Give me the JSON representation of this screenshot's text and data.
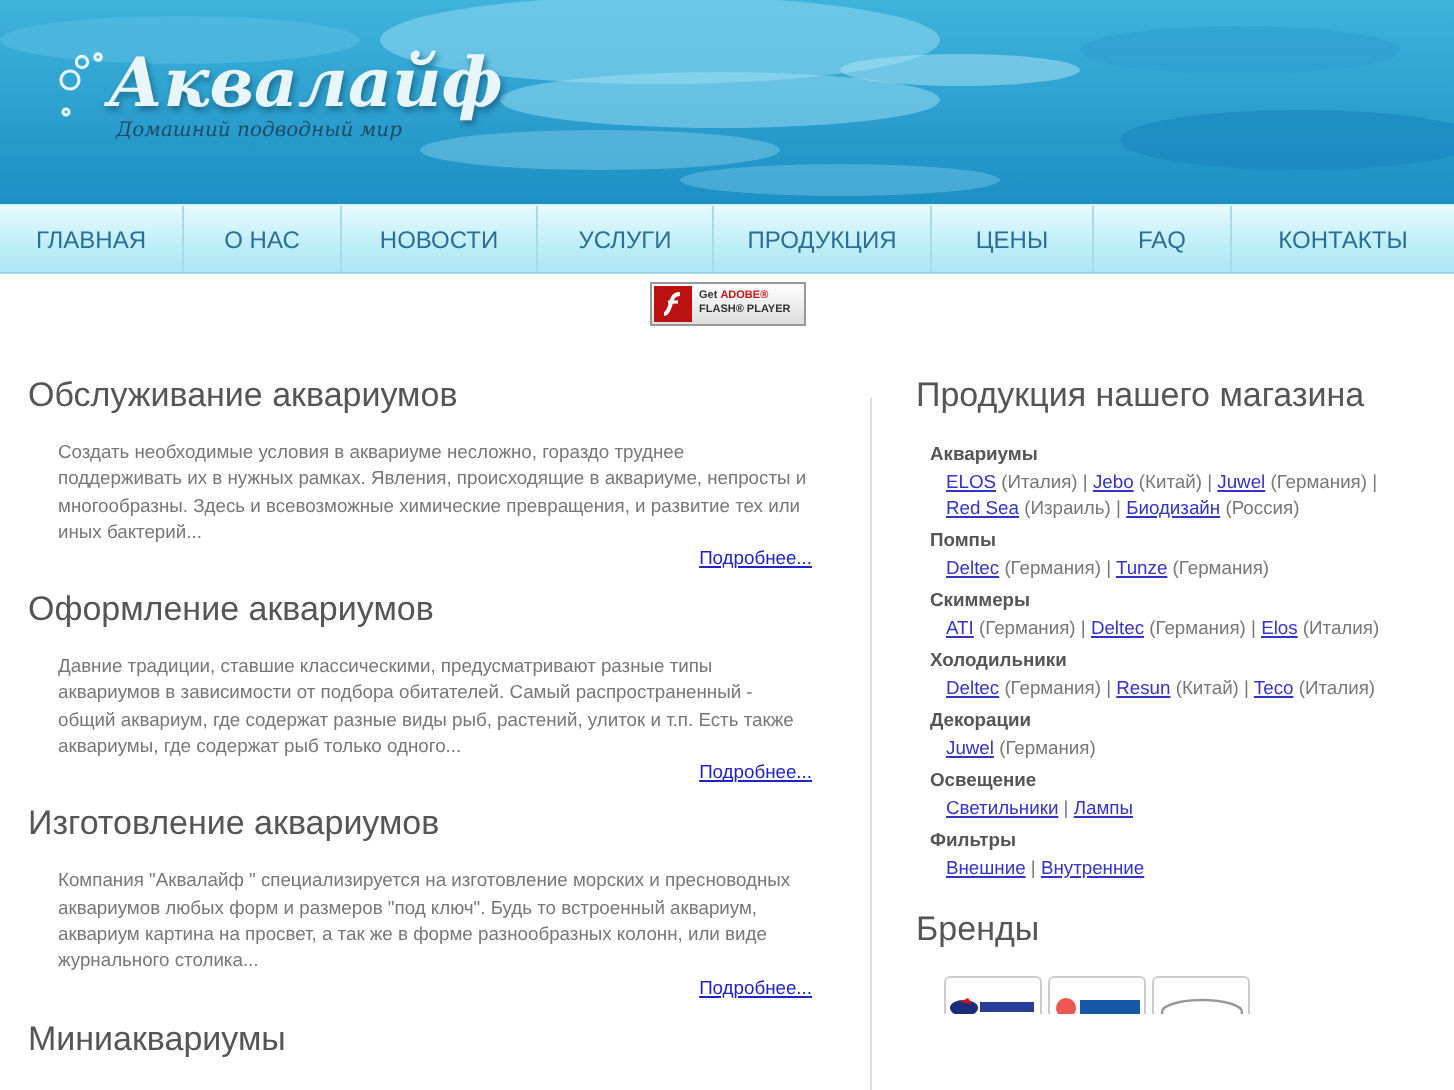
{
  "logo": {
    "title": "Аквалайф",
    "tagline": "Домашний подводный мир"
  },
  "nav": [
    {
      "label": "ГЛАВНАЯ"
    },
    {
      "label": "О НАС"
    },
    {
      "label": "НОВОСТИ"
    },
    {
      "label": "УСЛУГИ"
    },
    {
      "label": "ПРОДУКЦИЯ"
    },
    {
      "label": "ЦЕНЫ"
    },
    {
      "label": "FAQ"
    },
    {
      "label": "КОНТАКТЫ"
    }
  ],
  "flash_badge": {
    "line1": "Get",
    "brand": "ADOBE®",
    "line2": "FLASH® PLAYER"
  },
  "articles": [
    {
      "title": "Обслуживание аквариумов",
      "text": "Создать необходимые условия в аквариуме несложно, гораздо труднее поддерживать их в нужных рамках. Явления, происходящие в аквариуме, непросты и многообразны. Здесь и всевозможные химические превращения, и развитие тех или иных бактерий...",
      "more": "Подробнее..."
    },
    {
      "title": "Оформление аквариумов",
      "text": "Давние традиции, ставшие классическими, предусматривают разные типы аквариумов в зависимости от подбора обитателей. Самый распространенный - общий аквариум, где содержат разные виды рыб, растений, улиток и т.п. Есть также аквариумы, где содержат рыб только одного...",
      "more": "Подробнее..."
    },
    {
      "title": "Изготовление аквариумов",
      "text": "Компания \"Аквалайф \" специализируется на изготовление морских и пресноводных аквариумов любых форм и размеров \"под ключ\". Будь то встроенный аквариум, аквариум картина на просвет, а так же в форме разнообразных колонн, или виде журнального столика...",
      "more": "Подробнее..."
    },
    {
      "title": "Миниаквариумы"
    }
  ],
  "products": {
    "title": "Продукция нашего магазина",
    "separator": "|",
    "groups": [
      {
        "name": "Аквариумы",
        "items": [
          {
            "link": "ELOS",
            "note": "(Италия)"
          },
          {
            "link": "Jebo",
            "note": "(Китай)"
          },
          {
            "link": "Juwel",
            "note": "(Германия)"
          },
          {
            "link": "Red Sea",
            "note": "(Израиль)"
          },
          {
            "link": "Биодизайн",
            "note": "(Россия)"
          }
        ]
      },
      {
        "name": "Помпы",
        "items": [
          {
            "link": "Deltec",
            "note": "(Германия)"
          },
          {
            "link": "Tunze",
            "note": "(Германия)"
          }
        ]
      },
      {
        "name": "Скиммеры",
        "items": [
          {
            "link": "ATI",
            "note": "(Германия)"
          },
          {
            "link": "Deltec",
            "note": "(Германия)"
          },
          {
            "link": "Elos",
            "note": "(Италия)"
          }
        ]
      },
      {
        "name": "Холодильники",
        "items": [
          {
            "link": "Deltec",
            "note": "(Германия)"
          },
          {
            "link": "Resun",
            "note": "(Китай)"
          },
          {
            "link": "Teco",
            "note": "(Италия)"
          }
        ]
      },
      {
        "name": "Декорации",
        "items": [
          {
            "link": "Juwel",
            "note": "(Германия)"
          }
        ]
      },
      {
        "name": "Освещение",
        "items": [
          {
            "link": "Светильники"
          },
          {
            "link": "Лампы"
          }
        ]
      },
      {
        "name": "Фильтры",
        "items": [
          {
            "link": "Внешние"
          },
          {
            "link": "Внутренние"
          }
        ]
      }
    ]
  },
  "brands": {
    "title": "Бренды",
    "items": [
      {
        "kind": "resun"
      },
      {
        "kind": "teco"
      },
      {
        "kind": "deltec"
      }
    ]
  }
}
